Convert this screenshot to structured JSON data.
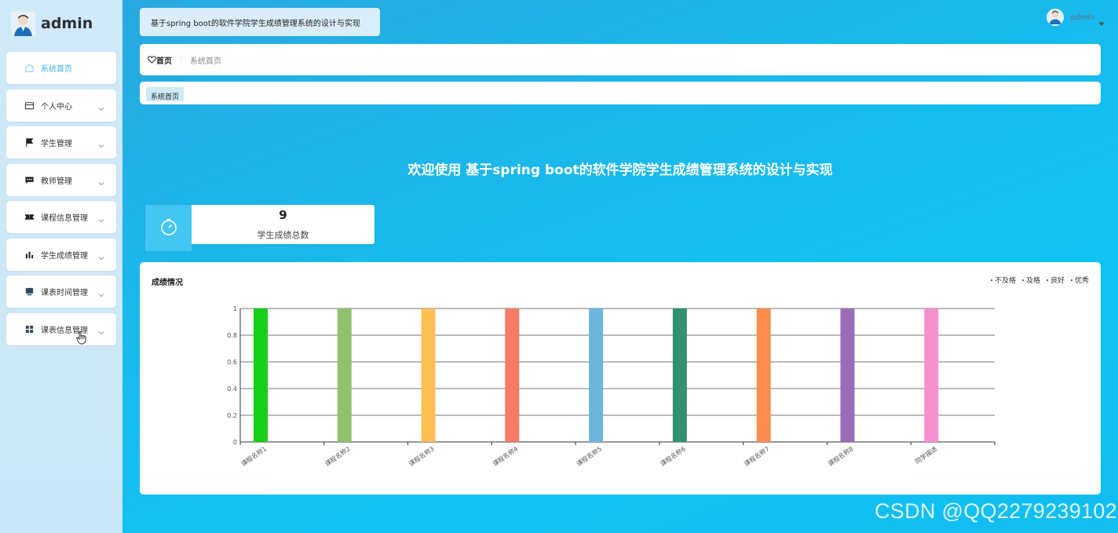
{
  "brand": {
    "title": "admin"
  },
  "sidebar": {
    "items": [
      {
        "label": "系统首页",
        "icon": "home-icon",
        "active": true,
        "expandable": false
      },
      {
        "label": "个人中心",
        "icon": "card-icon",
        "active": false,
        "expandable": true
      },
      {
        "label": "学生管理",
        "icon": "flag-icon",
        "active": false,
        "expandable": true
      },
      {
        "label": "教师管理",
        "icon": "message-icon",
        "active": false,
        "expandable": true
      },
      {
        "label": "课程信息管理",
        "icon": "ticket-icon",
        "active": false,
        "expandable": true
      },
      {
        "label": "学生成绩管理",
        "icon": "bar-chart-icon",
        "active": false,
        "expandable": true
      },
      {
        "label": "课表时间管理",
        "icon": "monitor-icon",
        "active": false,
        "expandable": true
      },
      {
        "label": "课表信息管理",
        "icon": "grid-icon",
        "active": false,
        "expandable": true
      }
    ]
  },
  "header": {
    "system_title": "基于spring boot的软件学院学生成绩管理系统的设计与实现",
    "user_name": "admin"
  },
  "breadcrumb": {
    "home": "首页",
    "current": "系统首页"
  },
  "tabs": [
    {
      "label": "系统首页"
    }
  ],
  "welcome": "欢迎使用 基于spring boot的软件学院学生成绩管理系统的设计与实现",
  "stat": {
    "value": "9",
    "label": "学生成绩总数"
  },
  "chart_card": {
    "title": "成绩情况",
    "legend": [
      "不及格",
      "及格",
      "良好",
      "优秀"
    ]
  },
  "chart_data": {
    "type": "bar",
    "title": "成绩情况",
    "categories": [
      "课程名称1",
      "课程名称2",
      "课程名称3",
      "课程名称4",
      "课程名称5",
      "课程名称6",
      "课程名称7",
      "课程名称8",
      "同学描述"
    ],
    "values": [
      1,
      1,
      1,
      1,
      1,
      1,
      1,
      1,
      1
    ],
    "bar_colors": [
      "#16d016",
      "#8fc16f",
      "#fac056",
      "#f87b69",
      "#6cb5dc",
      "#329170",
      "#fd8c4f",
      "#9b6cb6",
      "#f591cf"
    ],
    "legend": [
      "不及格",
      "及格",
      "良好",
      "优秀"
    ],
    "ylim": [
      0,
      1
    ],
    "yticks": [
      0,
      0.2,
      0.4,
      0.6,
      0.8,
      1
    ],
    "grid": true
  },
  "watermark": "CSDN @QQ2279239102"
}
